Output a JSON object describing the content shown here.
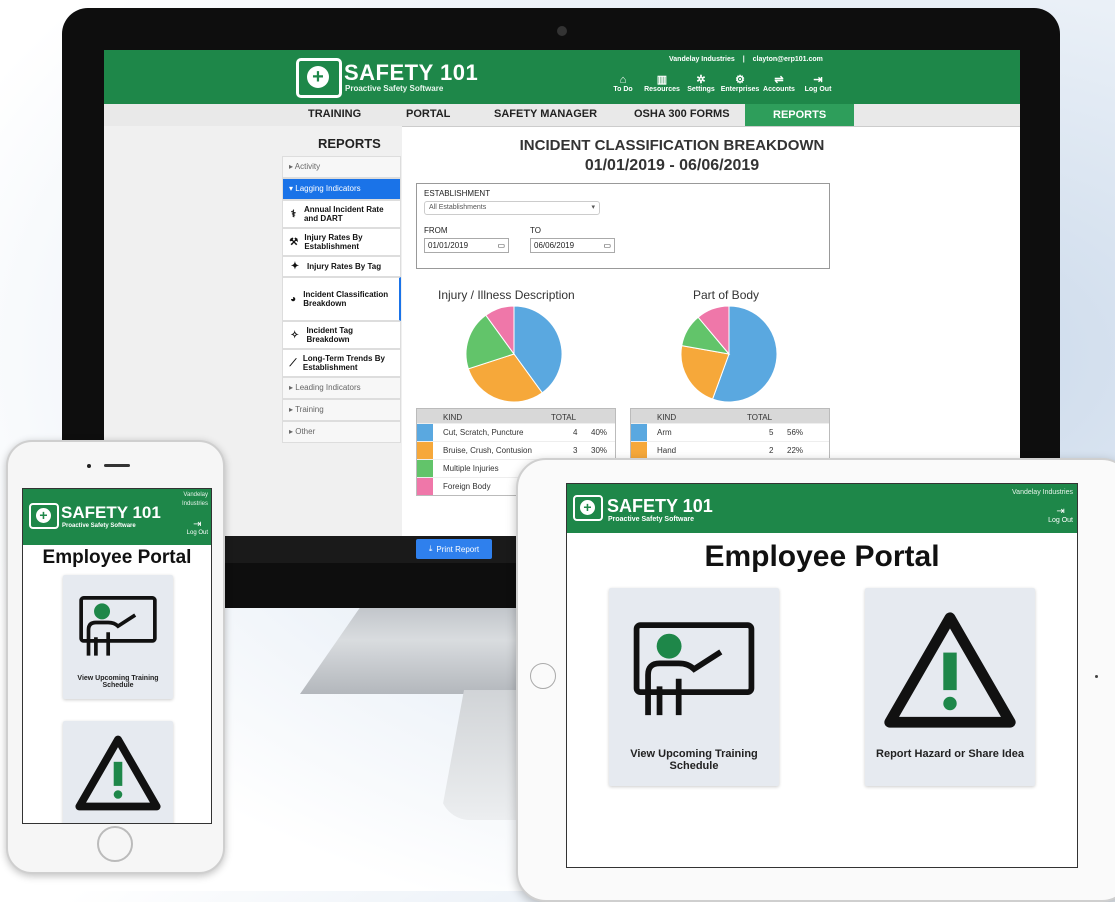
{
  "desktop": {
    "brand": "SAFETY 101",
    "tagline": "Proactive Safety Software",
    "company": "Vandelay Industries",
    "email": "clayton@erp101.com",
    "top_icons": [
      {
        "icon": "home-icon",
        "glyph": "⌂",
        "label": "To Do"
      },
      {
        "icon": "book-icon",
        "glyph": "▥",
        "label": "Resources"
      },
      {
        "icon": "gear-icon",
        "glyph": "✲",
        "label": "Settings"
      },
      {
        "icon": "enterprise-icon",
        "glyph": "⚙",
        "label": "Enterprises"
      },
      {
        "icon": "accounts-icon",
        "glyph": "⇌",
        "label": "Accounts"
      },
      {
        "icon": "logout-icon",
        "glyph": "⇥",
        "label": "Log Out"
      }
    ],
    "nav": [
      "TRAINING",
      "PORTAL",
      "SAFETY MANAGER",
      "OSHA 300 FORMS",
      "REPORTS"
    ],
    "sidebar": {
      "title": "REPORTS",
      "items": [
        {
          "label": "▸ Activity",
          "type": "group"
        },
        {
          "label": "▾ Lagging Indicators",
          "type": "active"
        },
        {
          "label": "Annual Incident Rate and DART",
          "icon": "⚕",
          "type": "sub"
        },
        {
          "label": "Injury Rates By Establishment",
          "icon": "⚒",
          "type": "sub"
        },
        {
          "label": "Injury Rates By Tag",
          "icon": "✦",
          "type": "sub"
        },
        {
          "label": "Incident Classification Breakdown",
          "icon": "◕",
          "type": "sub-selected"
        },
        {
          "label": "Incident Tag Breakdown",
          "icon": "✧",
          "type": "sub"
        },
        {
          "label": "Long-Term Trends By Establishment",
          "icon": "⟋",
          "type": "sub"
        },
        {
          "label": "▸ Leading Indicators",
          "type": "group"
        },
        {
          "label": "▸ Training",
          "type": "group"
        },
        {
          "label": "▸ Other",
          "type": "group"
        }
      ]
    },
    "report_title": "INCIDENT CLASSIFICATION BREAKDOWN",
    "report_range": "01/01/2019 - 06/06/2019",
    "filter": {
      "establishment_label": "ESTABLISHMENT",
      "establishment_value": "All Establishments",
      "from_label": "FROM",
      "from_value": "01/01/2019",
      "to_label": "TO",
      "to_value": "06/06/2019"
    },
    "print_label": "Print Report",
    "table_headers": {
      "kind": "KIND",
      "total": "TOTAL"
    }
  },
  "chart_data": [
    {
      "type": "pie",
      "title": "Injury / Illness Description",
      "categories": [
        "Cut, Scratch, Puncture",
        "Bruise, Crush, Contusion",
        "Multiple Injuries",
        "Foreign Body"
      ],
      "values": [
        4,
        3,
        2,
        1
      ],
      "percent_labels": [
        "40%",
        "30%",
        "",
        ""
      ],
      "colors": [
        "#5aa8e0",
        "#f6a83a",
        "#62c46a",
        "#ef77a9"
      ]
    },
    {
      "type": "pie",
      "title": "Part of Body",
      "categories": [
        "Arm",
        "Hand",
        "",
        ""
      ],
      "values": [
        5,
        2,
        1,
        1
      ],
      "percent_labels": [
        "56%",
        "22%",
        "",
        ""
      ],
      "colors": [
        "#5aa8e0",
        "#f6a83a",
        "#62c46a",
        "#ef77a9"
      ]
    }
  ],
  "phone": {
    "brand": "SAFETY 101",
    "tagline": "Proactive Safety Software",
    "company_line1": "Vandelay",
    "company_line2": "Industries",
    "logout": "Log Out",
    "title": "Employee Portal",
    "card1_label": "View Upcoming Training Schedule"
  },
  "tablet": {
    "brand": "SAFETY 101",
    "tagline": "Proactive Safety Software",
    "company": "Vandelay Industries",
    "logout": "Log Out",
    "title": "Employee Portal",
    "card1_label": "View Upcoming Training Schedule",
    "card2_label": "Report Hazard or Share Idea"
  },
  "colors": {
    "brand_green": "#1e8749",
    "active_tab": "#2e9e5b",
    "accent_blue": "#1a73e8"
  }
}
